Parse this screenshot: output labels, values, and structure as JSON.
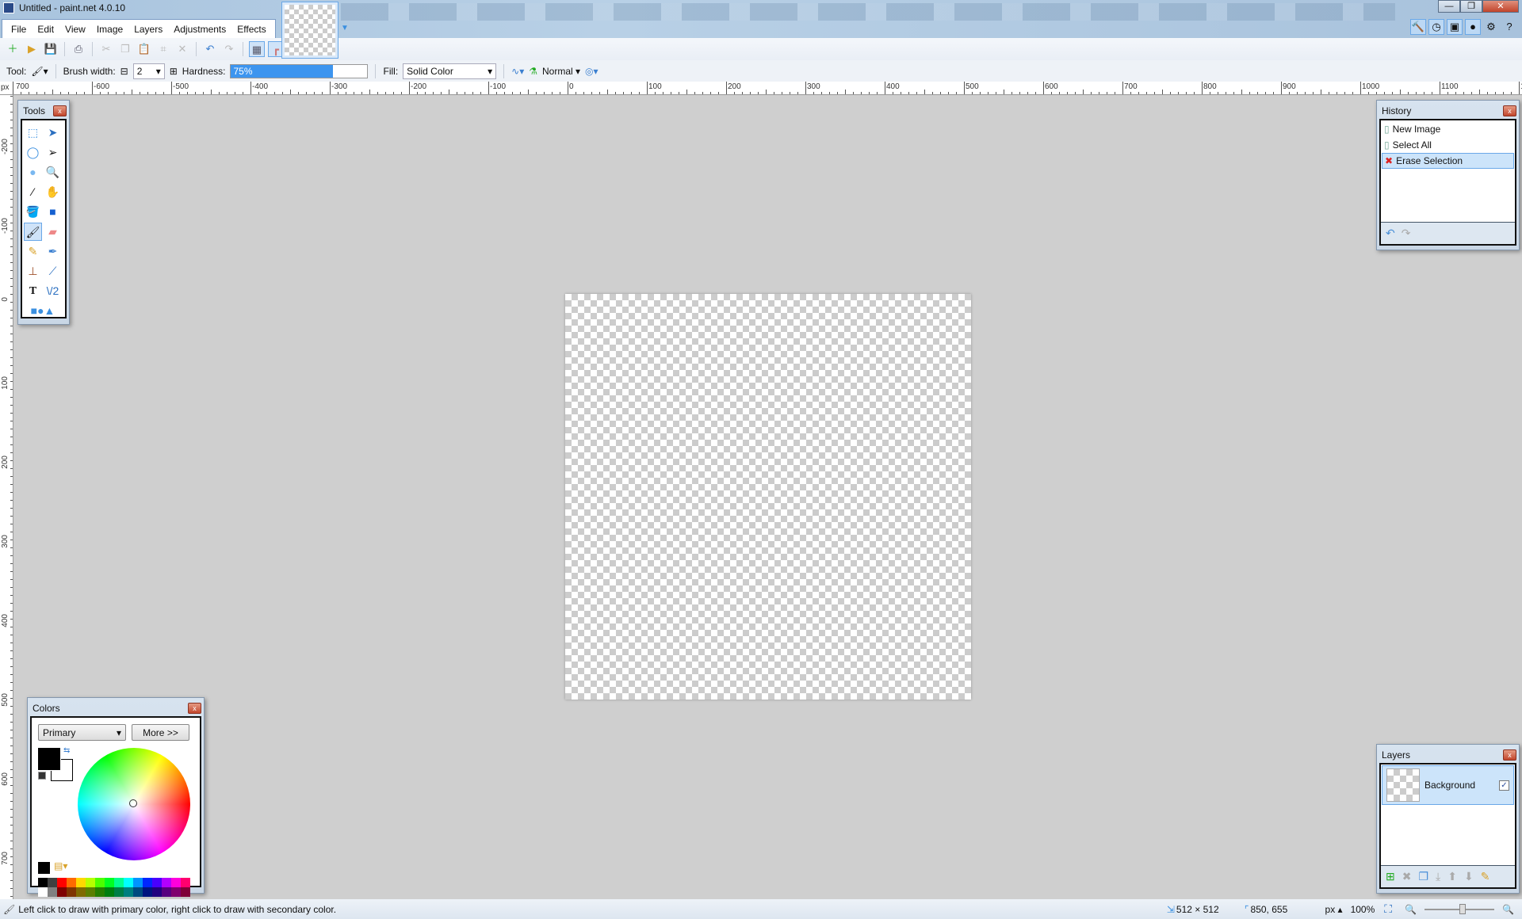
{
  "window": {
    "title": "Untitled - paint.net 4.0.10",
    "minimize": "—",
    "restore": "❐",
    "close": "✕"
  },
  "menu": [
    "File",
    "Edit",
    "View",
    "Image",
    "Layers",
    "Adjustments",
    "Effects"
  ],
  "right_icons": [
    {
      "name": "tools-window-icon",
      "glyph": "🔨"
    },
    {
      "name": "history-window-icon",
      "glyph": "◷"
    },
    {
      "name": "layers-window-icon",
      "glyph": "▣"
    },
    {
      "name": "colors-window-icon",
      "glyph": "●"
    },
    {
      "name": "settings-icon",
      "glyph": "⚙"
    },
    {
      "name": "help-icon",
      "glyph": "?"
    }
  ],
  "toolbar": {
    "icons": [
      "new",
      "open",
      "save",
      "print",
      "cut",
      "copy",
      "paste",
      "crop",
      "deselect",
      "undo",
      "redo",
      "pixel-grid",
      "rulers"
    ]
  },
  "options": {
    "tool_label": "Tool:",
    "brush_width_label": "Brush width:",
    "brush_width": "2",
    "hardness_label": "Hardness:",
    "hardness": "75%",
    "hardness_value": 75,
    "fill_label": "Fill:",
    "fill": "Solid Color",
    "blend_mode": "Normal"
  },
  "ruler": {
    "unit": "px",
    "top_labels": [
      "700",
      "-600",
      "-500",
      "-400",
      "-300",
      "-200",
      "-100",
      "0",
      "100",
      "200",
      "300",
      "400",
      "500",
      "600",
      "700",
      "800",
      "900",
      "1000",
      "1100",
      "1"
    ],
    "left_labels": [
      "-200",
      "-100",
      "0",
      "100",
      "200",
      "300",
      "400",
      "500",
      "600",
      "700"
    ]
  },
  "tools_panel": {
    "title": "Tools"
  },
  "history": {
    "title": "History",
    "items": [
      {
        "label": "New Image",
        "icon": "new-image-icon"
      },
      {
        "label": "Select All",
        "icon": "select-all-icon"
      },
      {
        "label": "Erase Selection",
        "icon": "erase-selection-icon",
        "selected": true
      }
    ]
  },
  "colors": {
    "title": "Colors",
    "mode": "Primary",
    "more": "More >>",
    "primary": "#000000",
    "secondary": "#ffffff",
    "palette_top": [
      "#000000",
      "#404040",
      "#ff0000",
      "#ff6a00",
      "#ffd800",
      "#b6ff00",
      "#4cff00",
      "#00ff21",
      "#00ff90",
      "#00ffff",
      "#0094ff",
      "#0026ff",
      "#4800ff",
      "#b200ff",
      "#ff00dc",
      "#ff006e"
    ],
    "palette_bottom": [
      "#ffffff",
      "#808080",
      "#7f0000",
      "#7f3300",
      "#7f6a00",
      "#5b7f00",
      "#267f00",
      "#007f0e",
      "#007f46",
      "#007f7f",
      "#004a7f",
      "#00137f",
      "#21007f",
      "#57007f",
      "#7f006e",
      "#7f0037"
    ]
  },
  "layers": {
    "title": "Layers",
    "items": [
      {
        "label": "Background",
        "visible": true
      }
    ]
  },
  "status": {
    "hint": "Left click to draw with primary color, right click to draw with secondary color.",
    "image_size": "512 × 512",
    "cursor": "850, 655",
    "unit": "px",
    "zoom": "100%"
  }
}
